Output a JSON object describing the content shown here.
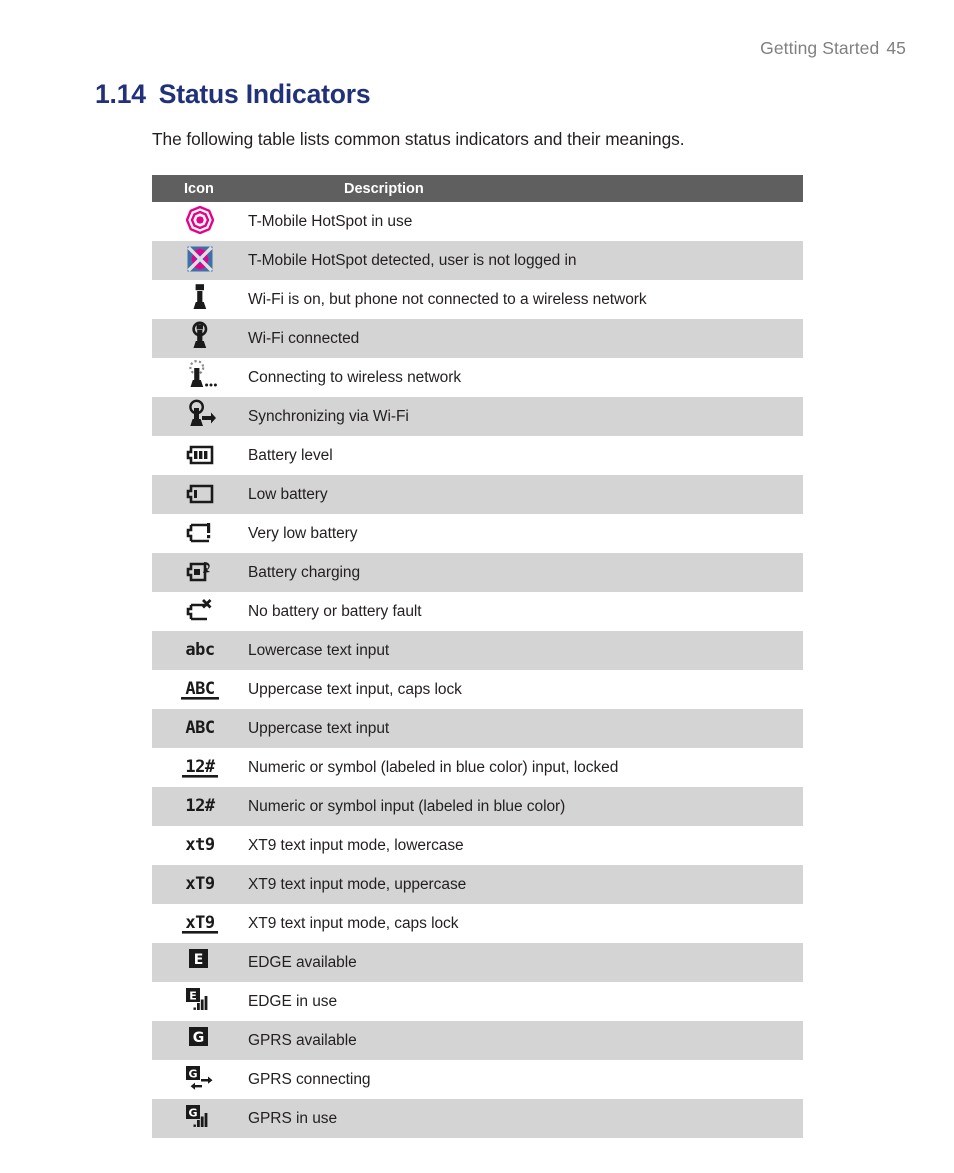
{
  "header": {
    "running_title": "Getting Started",
    "page_number": "45"
  },
  "section": {
    "number": "1.14",
    "title": "Status Indicators"
  },
  "intro": "The following table lists common status indicators and their meanings.",
  "colors": {
    "title_blue": "#21317a",
    "header_gray": "#5f5f5f",
    "row_alt_gray": "#d4d4d4",
    "text_black": "#231f20",
    "running_header_gray": "#808080",
    "tmobile_magenta": "#e6008c",
    "hotspot_blue": "#3f6fa8"
  },
  "table": {
    "columns": [
      "Icon",
      "Description"
    ],
    "rows": [
      {
        "icon": "tmobile-hotspot-in-use-icon",
        "description": "T-Mobile HotSpot in use",
        "shaded": false
      },
      {
        "icon": "tmobile-hotspot-detected-icon",
        "description": "T-Mobile HotSpot detected, user is not logged in",
        "shaded": true
      },
      {
        "icon": "wifi-on-not-connected-icon",
        "description": "Wi-Fi is on, but phone not connected to a wireless network",
        "shaded": false
      },
      {
        "icon": "wifi-connected-icon",
        "description": "Wi-Fi connected",
        "shaded": true
      },
      {
        "icon": "wifi-connecting-icon",
        "description": "Connecting to wireless network",
        "shaded": false
      },
      {
        "icon": "wifi-syncing-icon",
        "description": "Synchronizing via Wi-Fi",
        "shaded": true
      },
      {
        "icon": "battery-level-icon",
        "description": "Battery level",
        "shaded": false
      },
      {
        "icon": "battery-low-icon",
        "description": "Low battery",
        "shaded": true
      },
      {
        "icon": "battery-very-low-icon",
        "description": "Very low battery",
        "shaded": false
      },
      {
        "icon": "battery-charging-icon",
        "description": "Battery charging",
        "shaded": true
      },
      {
        "icon": "battery-fault-icon",
        "description": "No battery or battery fault",
        "shaded": false
      },
      {
        "icon": "text-input-lowercase-icon",
        "description": "Lowercase text input",
        "shaded": true
      },
      {
        "icon": "text-input-caps-lock-icon",
        "description": "Uppercase text input, caps lock",
        "shaded": false
      },
      {
        "icon": "text-input-uppercase-icon",
        "description": "Uppercase text input",
        "shaded": true
      },
      {
        "icon": "numeric-input-locked-icon",
        "description": "Numeric or symbol (labeled in blue color) input, locked",
        "shaded": false
      },
      {
        "icon": "numeric-input-icon",
        "description": "Numeric or symbol input (labeled in blue color)",
        "shaded": true
      },
      {
        "icon": "xt9-lowercase-icon",
        "description": "XT9 text input mode, lowercase",
        "shaded": false
      },
      {
        "icon": "xt9-uppercase-icon",
        "description": "XT9 text input mode, uppercase",
        "shaded": true
      },
      {
        "icon": "xt9-caps-lock-icon",
        "description": "XT9 text input mode, caps lock",
        "shaded": false
      },
      {
        "icon": "edge-available-icon",
        "description": "EDGE available",
        "shaded": true
      },
      {
        "icon": "edge-in-use-icon",
        "description": "EDGE in use",
        "shaded": false
      },
      {
        "icon": "gprs-available-icon",
        "description": "GPRS available",
        "shaded": true
      },
      {
        "icon": "gprs-connecting-icon",
        "description": "GPRS connecting",
        "shaded": false
      },
      {
        "icon": "gprs-in-use-icon",
        "description": "GPRS in use",
        "shaded": true
      }
    ]
  },
  "icon_labels": {
    "text_input_lowercase": "abc",
    "text_input_caps_lock": "ABC",
    "text_input_uppercase": "ABC",
    "numeric_input_locked": "12#",
    "numeric_input": "12#",
    "xt9_lowercase": "xt9",
    "xt9_uppercase": "xT9",
    "xt9_caps_lock": "xT9",
    "edge": "E",
    "gprs": "G"
  }
}
